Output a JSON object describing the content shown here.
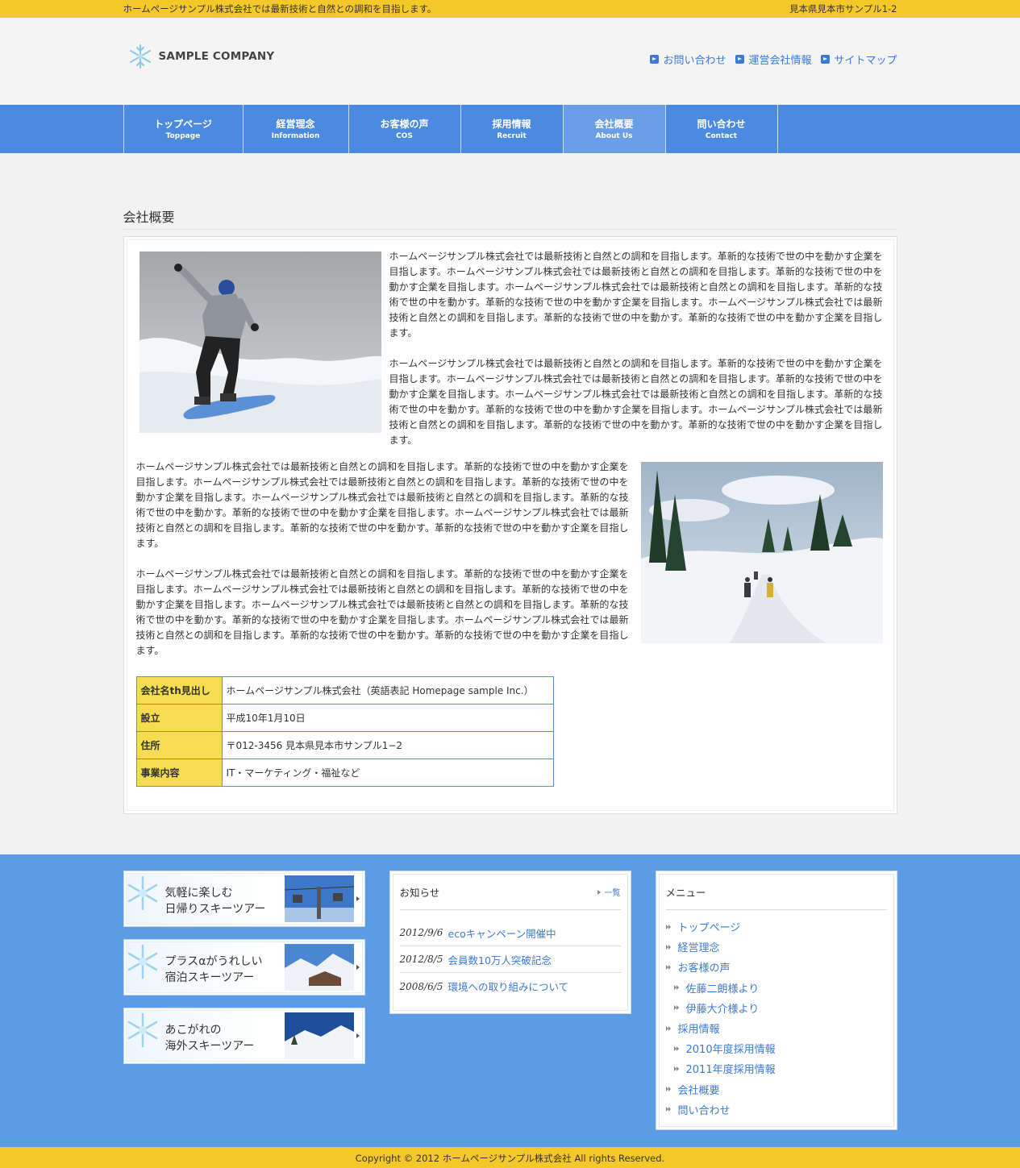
{
  "topbar": {
    "tagline": "ホームページサンプル株式会社では最新技術と自然との調和を目指します。",
    "address": "見本県見本市サンプル1-2"
  },
  "header": {
    "logo_text": "SAMPLE COMPANY",
    "links": [
      {
        "label": "お問い合わせ"
      },
      {
        "label": "運営会社情報"
      },
      {
        "label": "サイトマップ"
      }
    ]
  },
  "nav": [
    {
      "jp": "トップページ",
      "en": "Toppage"
    },
    {
      "jp": "経営理念",
      "en": "Information"
    },
    {
      "jp": "お客様の声",
      "en": "COS"
    },
    {
      "jp": "採用情報",
      "en": "Recruit"
    },
    {
      "jp": "会社概要",
      "en": "About Us",
      "active": true
    },
    {
      "jp": "問い合わせ",
      "en": "Contact"
    }
  ],
  "main": {
    "page_title": "会社概要",
    "paragraph": "ホームページサンプル株式会社では最新技術と自然との調和を目指します。革新的な技術で世の中を動かす企業を目指します。ホームページサンプル株式会社では最新技術と自然との調和を目指します。革新的な技術で世の中を動かす企業を目指します。ホームページサンプル株式会社では最新技術と自然との調和を目指します。革新的な技術で世の中を動かす。革新的な技術で世の中を動かす企業を目指します。ホームページサンプル株式会社では最新技術と自然との調和を目指します。革新的な技術で世の中を動かす。革新的な技術で世の中を動かす企業を目指します。",
    "table": [
      {
        "th": "会社名th見出し",
        "td": "ホームページサンプル株式会社（英語表記 Homepage sample Inc.）"
      },
      {
        "th": "設立",
        "td": "平成10年1月10日"
      },
      {
        "th": "住所",
        "td": "〒012-3456 見本県見本市サンプル1−2"
      },
      {
        "th": "事業内容",
        "td": "IT・マーケティング・福祉など"
      }
    ]
  },
  "footer": {
    "banners": [
      {
        "line1": "気軽に楽しむ",
        "line2": "日帰りスキーツアー"
      },
      {
        "line1": "プラスαがうれしい",
        "line2": "宿泊スキーツアー"
      },
      {
        "line1": "あこがれの",
        "line2": "海外スキーツアー"
      }
    ],
    "news": {
      "title": "お知らせ",
      "more": "一覧",
      "items": [
        {
          "date": "2012/9/6",
          "title": "ecoキャンペーン開催中"
        },
        {
          "date": "2012/8/5",
          "title": "会員数10万人突破記念"
        },
        {
          "date": "2008/6/5",
          "title": "環境への取り組みについて"
        }
      ]
    },
    "menu": {
      "title": "メニュー",
      "items": [
        {
          "label": "トップページ"
        },
        {
          "label": "経営理念"
        },
        {
          "label": "お客様の声"
        },
        {
          "label": "佐藤二朗様より"
        },
        {
          "label": "伊藤大介様より"
        },
        {
          "label": "採用情報"
        },
        {
          "label": "2010年度採用情報"
        },
        {
          "label": "2011年度採用情報"
        },
        {
          "label": "会社概要"
        },
        {
          "label": "問い合わせ"
        }
      ]
    },
    "copyright": "Copyright © 2012 ホームページサンプル株式会社 All rights Reserved."
  }
}
